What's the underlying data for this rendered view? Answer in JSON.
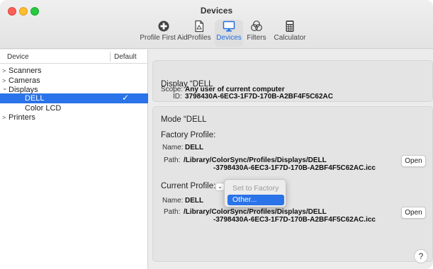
{
  "window": {
    "title": "Devices"
  },
  "toolbar": {
    "items": [
      {
        "label": "Profile First Aid",
        "icon": "first-aid-icon"
      },
      {
        "label": "Profiles",
        "icon": "profiles-icon"
      },
      {
        "label": "Devices",
        "icon": "display-icon",
        "active": true
      },
      {
        "label": "Filters",
        "icon": "filters-icon"
      },
      {
        "label": "Calculator",
        "icon": "calculator-icon"
      }
    ]
  },
  "sidebar": {
    "col_device": "Device",
    "col_default": "Default",
    "rows": [
      {
        "label": "Scanners",
        "disclosure": ">"
      },
      {
        "label": "Cameras",
        "disclosure": ">"
      },
      {
        "label": "Displays",
        "disclosure": "⌄"
      },
      {
        "label": "DELL",
        "selected": true,
        "default_check": "✓"
      },
      {
        "label": "Color LCD"
      },
      {
        "label": "Printers",
        "disclosure": ">"
      }
    ]
  },
  "display_panel": {
    "title": "Display “DELL",
    "id_label": "ID:",
    "id_value": "3798430A-6EC3-1F7D-170B-A2BF4F5C62AC",
    "scope_label": "Scope:",
    "scope_value": "Any user of current computer"
  },
  "mode_panel": {
    "title": "Mode “DELL",
    "factory_title": "Factory Profile:",
    "factory_name_label": "Name:",
    "factory_name_value": "DELL",
    "factory_path_label": "Path:",
    "factory_path_line1": "/Library/ColorSync/Profiles/Displays/DELL",
    "factory_path_line2": "-3798430A-6EC3-1F7D-170B-A2BF4F5C62AC.icc",
    "current_title": "Current Profile:",
    "current_name_label": "Name:",
    "current_name_value": "DELL",
    "current_path_label": "Path:",
    "current_path_line1": "/Library/ColorSync/Profiles/Displays/DELL",
    "current_path_line2": "-3798430A-6EC3-1F7D-170B-A2BF4F5C62AC.icc",
    "open_label": "Open",
    "help_label": "?"
  },
  "profile_menu": {
    "items": [
      "Set to Factory",
      "Other..."
    ],
    "highlighted": "Other..."
  },
  "colors": {
    "accent": "#2a73e8"
  }
}
